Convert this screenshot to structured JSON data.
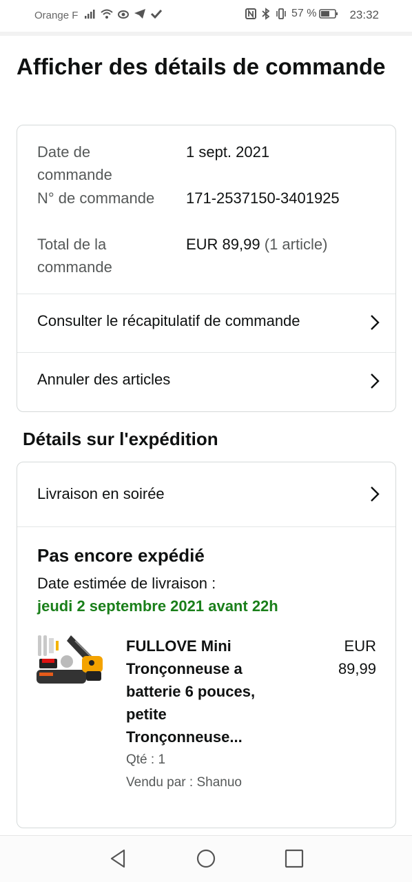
{
  "status_bar": {
    "carrier": "Orange F",
    "battery_percent": "57 %",
    "time": "23:32",
    "icons": [
      "signal-icon",
      "wifi-icon",
      "eye-icon",
      "telegram-icon",
      "check-icon",
      "nfc-icon",
      "bluetooth-icon",
      "vibrate-icon",
      "battery-icon"
    ]
  },
  "page": {
    "title": "Afficher des détails de commande"
  },
  "order_summary": {
    "date_label": "Date de commande",
    "date_value": "1 sept. 2021",
    "number_label": "N° de commande",
    "number_value": "171-2537150-3401925",
    "total_label": "Total de la commande",
    "total_value": "EUR 89,99",
    "total_count": "(1 article)",
    "links": [
      {
        "label": "Consulter le récapitulatif de commande"
      },
      {
        "label": "Annuler des articles"
      }
    ]
  },
  "shipping": {
    "section_title": "Détails sur l'expédition",
    "delivery_option": "Livraison en soirée",
    "status": "Pas encore expédié",
    "eta_label": "Date estimée de livraison :",
    "eta_date": "jeudi 2 septembre 2021 avant 22h",
    "eta_color": "#1a7f1a",
    "item": {
      "title": "FULLOVE Mini Tronçonneuse a batterie 6 pouces, petite Tronçonneuse...",
      "price": "EUR 89,99",
      "quantity": "Qté : 1",
      "seller": "Vendu par : Shanuo"
    }
  },
  "nav_bar": {
    "buttons": [
      "back-icon",
      "home-icon",
      "recents-icon"
    ]
  }
}
